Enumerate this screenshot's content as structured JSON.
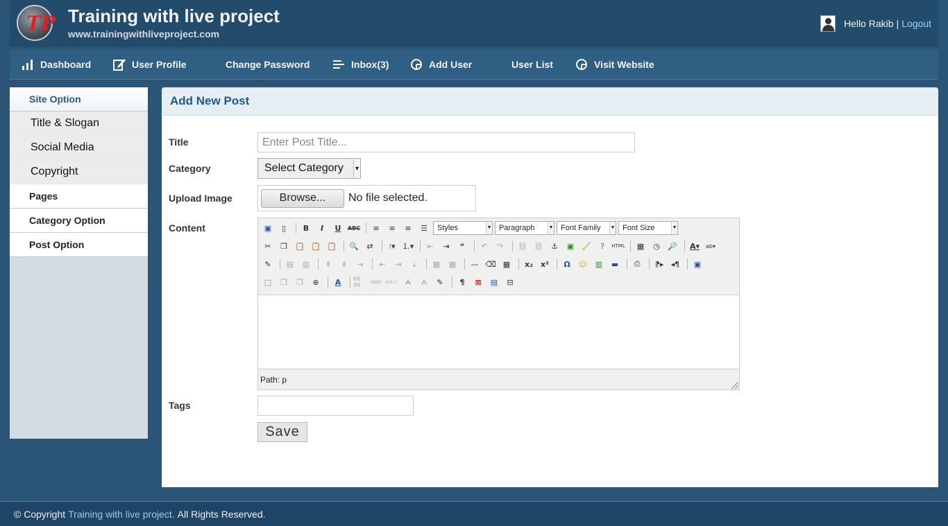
{
  "header": {
    "title": "Training with live project",
    "url": "www.trainingwithliveproject.com",
    "greeting": "Hello Rakib",
    "separator": "|",
    "logout": "Logout",
    "logo_text": "TP"
  },
  "nav": {
    "items": [
      {
        "label": "Dashboard",
        "icon": "bar-chart-icon"
      },
      {
        "label": "User Profile",
        "icon": "edit-icon"
      },
      {
        "label": "Change Password",
        "icon": ""
      },
      {
        "label": "Inbox(3)",
        "icon": "list-icon"
      },
      {
        "label": "Add User",
        "icon": "globe-icon"
      },
      {
        "label": "User List",
        "icon": ""
      },
      {
        "label": "Visit Website",
        "icon": "globe-icon"
      }
    ]
  },
  "sidebar": {
    "site_option": "Site Option",
    "items": [
      "Title & Slogan",
      "Social Media",
      "Copyright"
    ],
    "pages": "Pages",
    "category_option": "Category Option",
    "post_option": "Post Option"
  },
  "form": {
    "heading": "Add New Post",
    "title_label": "Title",
    "title_placeholder": "Enter Post Title...",
    "category_label": "Category",
    "category_value": "Select Category",
    "upload_label": "Upload Image",
    "browse_label": "Browse...",
    "file_status": "No file selected.",
    "content_label": "Content",
    "tags_label": "Tags",
    "save_label": "Save"
  },
  "editor": {
    "styles": "Styles",
    "paragraph": "Paragraph",
    "font_family": "Font Family",
    "font_size": "Font Size",
    "path": "Path: p"
  },
  "footer": {
    "prefix": "© Copyright",
    "brand": "Training with live project.",
    "suffix": "All Rights Reserved."
  },
  "colors": {
    "background": "#2a5577",
    "header": "#234b6c",
    "nav": "#2f5f83",
    "accent": "#1f5a8c",
    "link": "#9ed0ff"
  }
}
